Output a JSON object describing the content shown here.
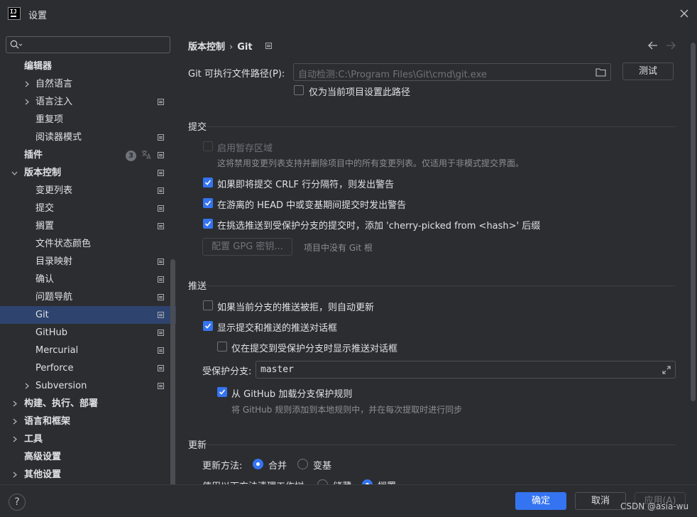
{
  "window": {
    "title": "设置",
    "logo_text": "IJ"
  },
  "search": {
    "placeholder": "",
    "value": ""
  },
  "sidebar": {
    "items": [
      {
        "label": "编辑器"
      },
      {
        "label": "自然语言"
      },
      {
        "label": "语言注入"
      },
      {
        "label": "重复项"
      },
      {
        "label": "阅读器模式"
      },
      {
        "label": "插件",
        "badge": "3"
      },
      {
        "label": "版本控制"
      },
      {
        "label": "变更列表"
      },
      {
        "label": "提交"
      },
      {
        "label": "搁置"
      },
      {
        "label": "文件状态颜色"
      },
      {
        "label": "目录映射"
      },
      {
        "label": "确认"
      },
      {
        "label": "问题导航"
      },
      {
        "label": "Git"
      },
      {
        "label": "GitHub"
      },
      {
        "label": "Mercurial"
      },
      {
        "label": "Perforce"
      },
      {
        "label": "Subversion"
      },
      {
        "label": "构建、执行、部署"
      },
      {
        "label": "语言和框架"
      },
      {
        "label": "工具"
      },
      {
        "label": "高级设置"
      },
      {
        "label": "其他设置"
      }
    ]
  },
  "breadcrumb": {
    "parent": "版本控制",
    "sep": "›",
    "current": "Git"
  },
  "git_path": {
    "label": "Git 可执行文件路径(P):",
    "placeholder": "自动检测:C:\\Program Files\\Git\\cmd\\git.exe",
    "test_button": "测试",
    "project_only": "仅为当前项目设置此路径"
  },
  "commit": {
    "title": "提交",
    "staging": "启用暂存区域",
    "staging_hint": "这将禁用变更列表支持并删除项目中的所有变更列表。仅适用于非模式提交界面。",
    "crlf": "如果即将提交 CRLF 行分隔符，则发出警告",
    "detached": "在游离的 HEAD 中或变基期间提交时发出警告",
    "cherry": "在挑选推送到受保护分支的提交时，添加 'cherry-picked from <hash>' 后缀",
    "gpg_button": "配置 GPG 密钥...",
    "gpg_note": "项目中没有 Git 根"
  },
  "push": {
    "title": "推送",
    "auto_update": "如果当前分支的推送被拒，则自动更新",
    "show_dialog": "显示提交和推送的推送对话框",
    "protected_only": "仅在提交到受保护分支时显示推送对话框",
    "protected_label": "受保护分支:",
    "protected_value": "master",
    "load_github": "从 GitHub 加载分支保护规则",
    "load_github_hint": "将 GitHub 规则添加到本地规则中，并在每次提取时进行同步"
  },
  "update": {
    "title": "更新",
    "method_label": "更新方法:",
    "merge": "合并",
    "rebase": "变基",
    "clean_label": "使用以下方法清理工作树:",
    "stash": "储藏",
    "shelve": "搁置"
  },
  "footer": {
    "help": "?",
    "ok": "确定",
    "cancel": "取消",
    "apply": "应用(A)",
    "watermark": "CSDN @asia-wu"
  },
  "colors": {
    "accent": "#3574f0",
    "selection": "#2e436e",
    "background": "#2b2d30"
  }
}
